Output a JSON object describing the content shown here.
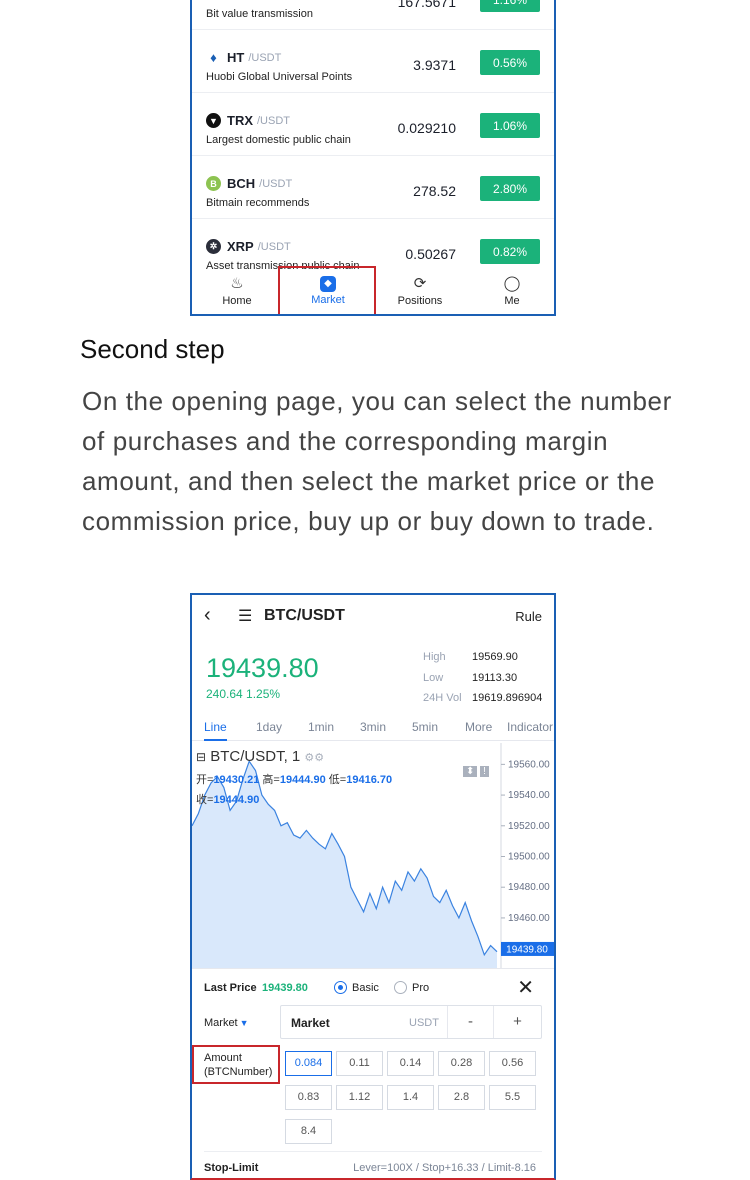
{
  "list_screen": {
    "first_row_desc": "Bit value transmission",
    "first_row_price": "167.5671",
    "first_row_pct": "1.16%",
    "coins": [
      {
        "symbol": "HT",
        "pair": "/USDT",
        "desc": "Huobi Global Universal Points",
        "price": "3.9371",
        "pct": "0.56%",
        "icon": "huobi-flame-icon",
        "color": "#1a5fb4"
      },
      {
        "symbol": "TRX",
        "pair": "/USDT",
        "desc": "Largest domestic public chain",
        "price": "0.029210",
        "pct": "1.06%",
        "icon": "tron-icon",
        "color": "#111111"
      },
      {
        "symbol": "BCH",
        "pair": "/USDT",
        "desc": "Bitmain recommends",
        "price": "278.52",
        "pct": "2.80%",
        "icon": "bitcoin-cash-icon",
        "color": "#8dc351"
      },
      {
        "symbol": "XRP",
        "pair": "/USDT",
        "desc": "Asset transmission public chain",
        "price": "0.50267",
        "pct": "0.82%",
        "icon": "ripple-icon",
        "color": "#2b2e3a"
      }
    ],
    "tabs": [
      {
        "label": "Home",
        "icon": "home-icon"
      },
      {
        "label": "Market",
        "icon": "market-icon"
      },
      {
        "label": "Positions",
        "icon": "positions-icon"
      },
      {
        "label": "Me",
        "icon": "profile-icon"
      }
    ]
  },
  "instructions": {
    "title": "Second step",
    "body": "On the opening page, you can select the number of purchases and the corresponding margin amount, and then select the market price or the commission price, buy up or buy down to trade."
  },
  "trade_screen": {
    "header": {
      "back": "‹",
      "pair": "BTC/USDT",
      "rule": "Rule"
    },
    "price": "19439.80",
    "change": "240.64  1.25%",
    "stats": [
      {
        "label": "High",
        "value": "19569.90"
      },
      {
        "label": "Low",
        "value": "19113.30"
      },
      {
        "label": "24H Vol",
        "value": "19619.896904"
      }
    ],
    "timeframes": [
      "Line",
      "1day",
      "1min",
      "3min",
      "5min",
      "More",
      "Indicator"
    ],
    "legend": {
      "symbol": "BTC/USDT, 1",
      "open_lbl": "开=",
      "open": "19430.21",
      "high_lbl": "高=",
      "high": "19444.90",
      "low_lbl": "低=",
      "low": "19416.70",
      "close_lbl": "收=",
      "close": "19444.90"
    },
    "panel": {
      "last_price_label": "Last Price",
      "last_price": "19439.80",
      "mode_basic": "Basic",
      "mode_pro": "Pro",
      "order_type": "Market",
      "box_label": "Market",
      "box_unit": "USDT",
      "minus": "-",
      "plus": "+",
      "amount_label_1": "Amount",
      "amount_label_2": "(BTCNumber)",
      "amounts": [
        "0.084",
        "0.11",
        "0.14",
        "0.28",
        "0.56",
        "0.83",
        "1.12",
        "1.4",
        "2.8",
        "5.5",
        "8.4"
      ],
      "stop_limit": "Stop-Limit",
      "lever_info": "Lever=100X / Stop+16.33 / Limit-8.16"
    }
  },
  "chart_data": {
    "type": "area",
    "title": "",
    "xlabel": "",
    "ylabel": "",
    "ylim": [
      19430,
      19570
    ],
    "yticks": [
      "19560.00",
      "19540.00",
      "19520.00",
      "19500.00",
      "19480.00",
      "19460.00"
    ],
    "last_label": "19439.80",
    "series": [
      {
        "values": [
          19520,
          19528,
          19540,
          19548,
          19552,
          19545,
          19530,
          19536,
          19550,
          19562,
          19556,
          19540,
          19534,
          19530,
          19520,
          19522,
          19514,
          19512,
          19517,
          19512,
          19508,
          19505,
          19515,
          19508,
          19500,
          19480,
          19472,
          19464,
          19476,
          19466,
          19480,
          19470,
          19484,
          19478,
          19490,
          19484,
          19492,
          19486,
          19474,
          19470,
          19478,
          19468,
          19460,
          19470,
          19458,
          19448,
          19436,
          19442,
          19438
        ]
      }
    ],
    "colors": {
      "line": "#3b83e0",
      "fill": "#d9e8fb",
      "up": "#1bb27a",
      "accent": "#1a6ee8",
      "highlight": "#c8262b"
    }
  }
}
